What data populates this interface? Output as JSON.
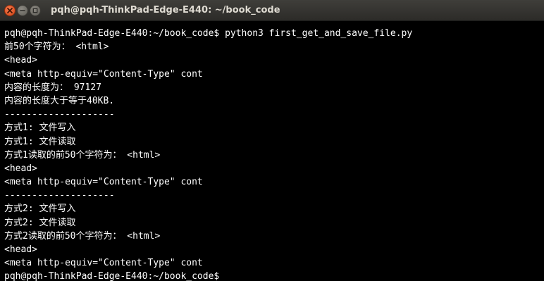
{
  "window": {
    "title": "pqh@pqh-ThinkPad-Edge-E440: ~/book_code",
    "close_icon": "close-icon",
    "minimize_icon": "minimize-icon",
    "maximize_icon": "maximize-icon"
  },
  "terminal": {
    "background": "#000000",
    "foreground": "#ffffff",
    "lines": [
      "pqh@pqh-ThinkPad-Edge-E440:~/book_code$ python3 first_get_and_save_file.py",
      "前50个字符为： <html>",
      "<head>",
      "<meta http-equiv=\"Content-Type\" cont",
      "内容的长度为： 97127",
      "内容的长度大于等于40KB.",
      "--------------------",
      "方式1: 文件写入",
      "方式1: 文件读取",
      "方式1读取的前50个字符为： <html>",
      "<head>",
      "<meta http-equiv=\"Content-Type\" cont",
      "--------------------",
      "方式2: 文件写入",
      "方式2: 文件读取",
      "方式2读取的前50个字符为： <html>",
      "<head>",
      "<meta http-equiv=\"Content-Type\" cont",
      "pqh@pqh-ThinkPad-Edge-E440:~/book_code$"
    ]
  }
}
